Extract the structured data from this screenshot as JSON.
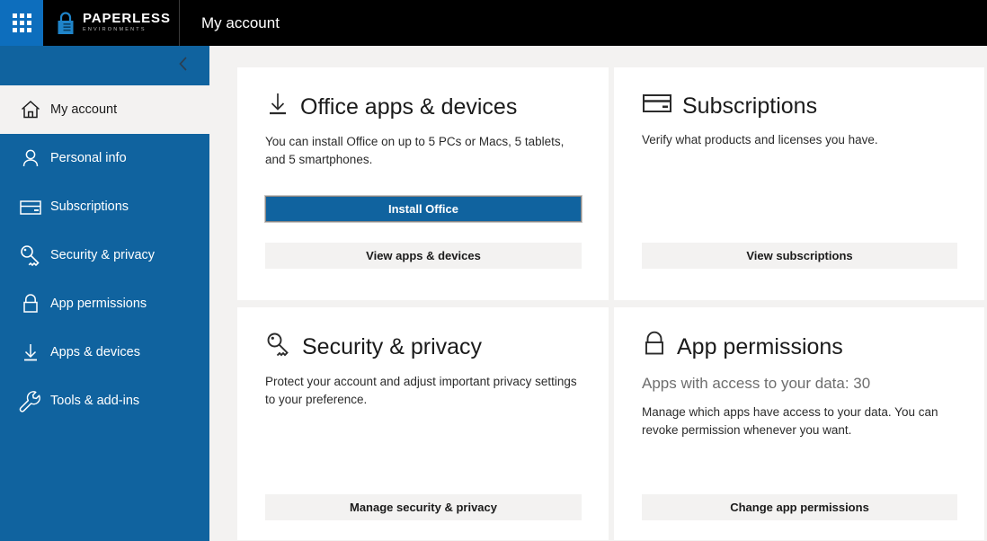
{
  "topbar": {
    "waffle_icon": "app-launcher-waffle-icon",
    "brand_lock_icon": "padlock-icon",
    "brand_name": "PAPERLESS",
    "brand_sub": "ENVIRONMENTS",
    "app_title": "My account"
  },
  "sidebar": {
    "collapse_icon": "chevron-left-icon",
    "items": [
      {
        "label": "My account",
        "icon": "home-icon",
        "active": true
      },
      {
        "label": "Personal info",
        "icon": "person-icon",
        "active": false
      },
      {
        "label": "Subscriptions",
        "icon": "credit-card-icon",
        "active": false
      },
      {
        "label": "Security & privacy",
        "icon": "key-icon",
        "active": false
      },
      {
        "label": "App permissions",
        "icon": "lock-icon",
        "active": false
      },
      {
        "label": "Apps & devices",
        "icon": "download-icon",
        "active": false
      },
      {
        "label": "Tools & add-ins",
        "icon": "wrench-icon",
        "active": false
      }
    ]
  },
  "cards": [
    {
      "icon": "download-icon",
      "title": "Office apps & devices",
      "subtitle": "",
      "description": "You can install Office on up to 5 PCs or Macs, 5 tablets, and 5 smartphones.",
      "primary_button": "Install Office",
      "secondary_button": "View apps & devices"
    },
    {
      "icon": "credit-card-icon",
      "title": "Subscriptions",
      "subtitle": "",
      "description": "Verify what products and licenses you have.",
      "primary_button": "",
      "secondary_button": "View subscriptions"
    },
    {
      "icon": "key-icon",
      "title": "Security & privacy",
      "subtitle": "",
      "description": "Protect your account and adjust important privacy settings to your preference.",
      "primary_button": "",
      "secondary_button": "Manage security & privacy"
    },
    {
      "icon": "lock-icon",
      "title": "App permissions",
      "subtitle": "Apps with access to your data: 30",
      "description": "Manage which apps have access to your data. You can revoke permission whenever you want.",
      "primary_button": "",
      "secondary_button": "Change app permissions"
    }
  ],
  "colors": {
    "brand_blue": "#10639f",
    "waffle_blue": "#0d6ebd",
    "topbar_black": "#000000",
    "page_bg": "#f3f2f1",
    "card_bg": "#ffffff"
  }
}
